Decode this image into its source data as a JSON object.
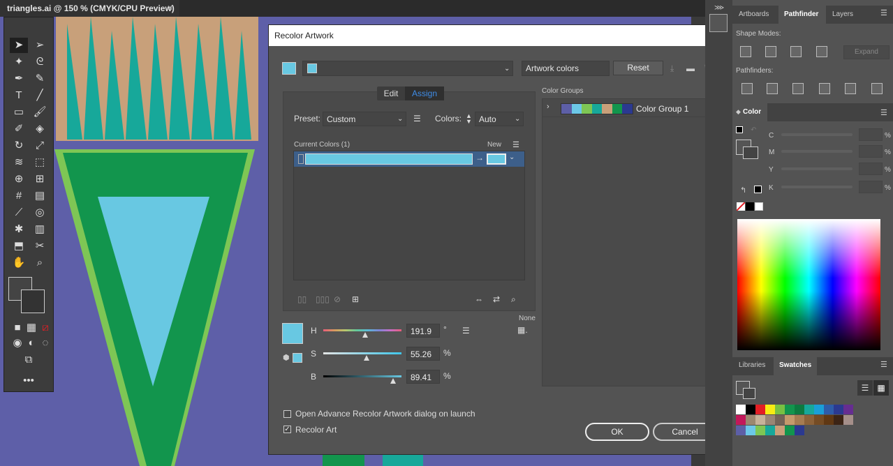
{
  "document": {
    "tab_title": "triangles.ai @ 150 % (CMYK/CPU Preview)",
    "close": "×"
  },
  "dialog": {
    "title": "Recolor Artwork",
    "close": "×",
    "artwork_colors": "Artwork colors",
    "reset": "Reset",
    "tabs": [
      "Edit",
      "Assign"
    ],
    "preset_label": "Preset:",
    "preset_value": "Custom",
    "colors_label": "Colors:",
    "colors_value": "Auto",
    "current_colors_label": "Current Colors (1)",
    "new_label": "New",
    "color_groups_label": "Color Groups",
    "color_group_name": "Color Group 1",
    "group_swatches": [
      "#5d5fa7",
      "#6cc8e8",
      "#7ec655",
      "#17a89a",
      "#c8a07a",
      "#12954d",
      "#2b3990"
    ],
    "current_color": "#68c8e2",
    "none_label": "None",
    "h_label": "H",
    "h_value": "191.9",
    "h_unit": "°",
    "s_label": "S",
    "s_value": "55.26",
    "s_unit": "%",
    "b_label": "B",
    "b_value": "89.41",
    "b_unit": "%",
    "checkbox_advanced": "Open Advance Recolor Artwork dialog on launch",
    "checkbox_recolor": "Recolor Art",
    "ok": "OK",
    "cancel": "Cancel"
  },
  "right_panel": {
    "tabs_top": [
      "Artboards",
      "Pathfinder",
      "Layers"
    ],
    "shape_modes": "Shape Modes:",
    "expand": "Expand",
    "pathfinders": "Pathfinders:",
    "color_tab": "Color",
    "cmyk": [
      "C",
      "M",
      "Y",
      "K"
    ],
    "pct": "%",
    "tabs_bottom": [
      "Libraries",
      "Swatches"
    ],
    "swatch_row1": [
      "#ffffff",
      "#000000",
      "#e31e24",
      "#f7ec13",
      "#78c043",
      "#12954d",
      "#0d7a40",
      "#17a89a",
      "#1a9fd7",
      "#2e5ca8",
      "#2b3990",
      "#662d91"
    ],
    "swatch_row2": [
      "#c2185b",
      "#9c8870",
      "#c7b299",
      "#998675",
      "#736357",
      "#c49a6c",
      "#a67c52",
      "#8c6239",
      "#754c24",
      "#603813",
      "#3c2415",
      "#a58f8a"
    ],
    "swatch_row3": [
      "#5d5fa7",
      "#6cc8e8",
      "#7ec655",
      "#17a89a",
      "#c8a07a",
      "#12954d",
      "#2b3990"
    ]
  },
  "colors": {
    "canvas": "#5e5fa8",
    "accent": "#3f8ce6"
  }
}
